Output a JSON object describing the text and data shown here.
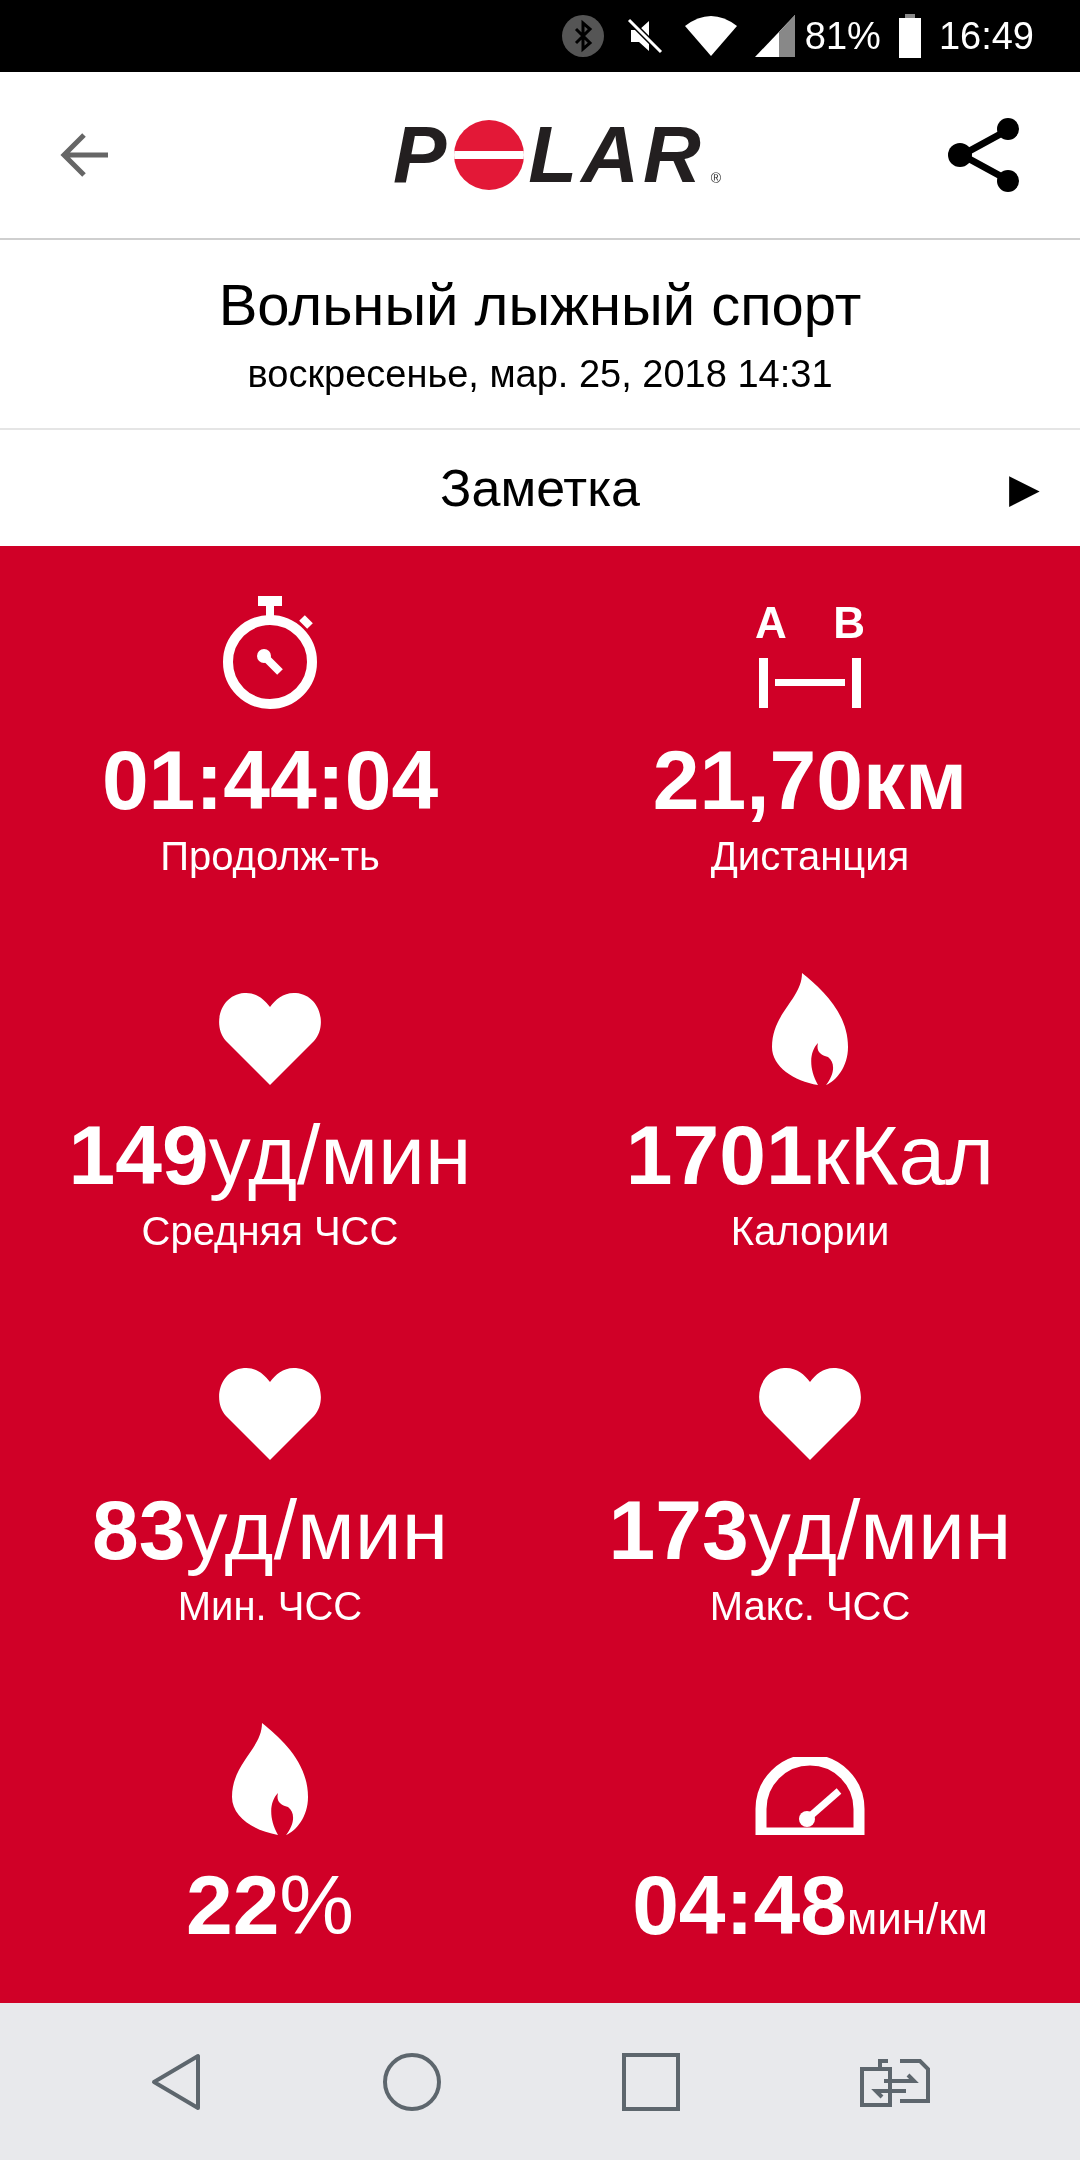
{
  "status_bar": {
    "battery_text": "81%",
    "time": "16:49"
  },
  "header": {
    "logo": [
      {
        "kind": "letters",
        "text": "P"
      },
      {
        "kind": "ring"
      },
      {
        "kind": "letters",
        "text": "LAR"
      }
    ],
    "logo_mark": "®"
  },
  "title": "Вольный лыжный спорт",
  "date": "воскресенье, мар. 25, 2018 14:31",
  "note": {
    "label": "Заметка",
    "arrow": "▶"
  },
  "distance_icon_labels": [
    "A",
    "B"
  ],
  "stats": [
    {
      "kind": "stopwatch",
      "value": "01:44:04",
      "label": "Продолж-ть"
    },
    {
      "kind": "distance",
      "value": "21,70",
      "unit": "км",
      "small_unit": false,
      "label": "Дистанция"
    },
    {
      "kind": "heart",
      "value": "149",
      "unit": "уд/мин",
      "small_unit": false,
      "label": "Средняя ЧСС"
    },
    {
      "kind": "flame",
      "value": "1701",
      "unit": "кКал",
      "small_unit": false,
      "label": "Калории"
    },
    {
      "kind": "heart",
      "value": "83",
      "unit": "уд/мин",
      "small_unit": false,
      "label": "Мин. ЧСС"
    },
    {
      "kind": "heart",
      "value": "173",
      "unit": "уд/мин",
      "small_unit": false,
      "label": "Макс. ЧСС"
    },
    {
      "kind": "flame",
      "value": "22",
      "unit": "%",
      "small_unit": false
    },
    {
      "kind": "gauge",
      "value": "04:48",
      "unit": "мин/км",
      "small_unit": true
    }
  ]
}
